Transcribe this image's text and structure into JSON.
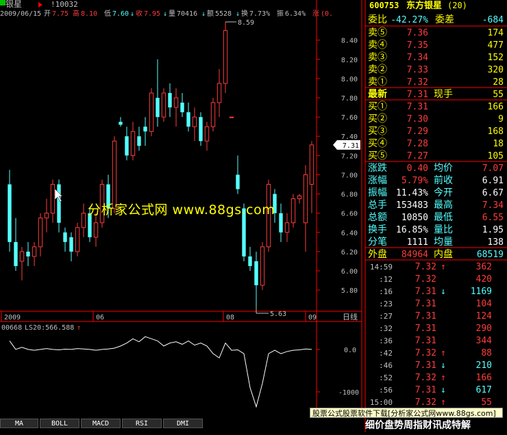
{
  "header": {
    "stock_name": "银星",
    "code_ref": "!10032",
    "date": "2009/06/15",
    "open_label": "开",
    "open": "7.75",
    "high_label": "高",
    "high": "8.10",
    "low_label": "低",
    "low": "7.60",
    "close_label": "收",
    "close": "7.95",
    "vol_label": "量",
    "vol": "70416",
    "amt_label": "额",
    "amt": "5528",
    "turn_label": "换",
    "turn": "7.73%",
    "amp_label": "振",
    "amp": "6.34%",
    "chg_label": "涨",
    "chg": "(0."
  },
  "chart": {
    "y_ticks": [
      "8.40",
      "8.20",
      "8.00",
      "7.80",
      "7.60",
      "7.40",
      "7.20",
      "7.00",
      "6.80",
      "6.60",
      "6.40",
      "6.20",
      "6.00",
      "5.80"
    ],
    "x_labels": [
      "2009",
      "06",
      "08",
      "09"
    ],
    "period_label": "日线",
    "current_price_label": "7.31",
    "max_label": "8.59",
    "min_label": "5.63"
  },
  "chart_data": [
    {
      "type": "candlestick",
      "title": "",
      "ylim": [
        5.63,
        8.59
      ],
      "y_ticks": [
        8.4,
        8.2,
        8.0,
        7.8,
        7.6,
        7.4,
        7.2,
        7.0,
        6.8,
        6.6,
        6.4,
        6.2,
        6.0,
        5.8
      ],
      "x_tick_labels": [
        "2009",
        "06",
        "08",
        "09"
      ],
      "candles": [
        {
          "o": 6.9,
          "h": 7.05,
          "l": 6.2,
          "c": 6.3
        },
        {
          "o": 6.3,
          "h": 6.55,
          "l": 6.0,
          "c": 6.05
        },
        {
          "o": 6.1,
          "h": 6.25,
          "l": 5.9,
          "c": 6.2
        },
        {
          "o": 6.2,
          "h": 6.3,
          "l": 6.05,
          "c": 6.15
        },
        {
          "o": 6.15,
          "h": 6.3,
          "l": 6.05,
          "c": 6.25
        },
        {
          "o": 6.25,
          "h": 6.6,
          "l": 6.15,
          "c": 6.55
        },
        {
          "o": 6.55,
          "h": 6.75,
          "l": 6.4,
          "c": 6.6
        },
        {
          "o": 6.6,
          "h": 6.95,
          "l": 6.5,
          "c": 6.9
        },
        {
          "o": 6.9,
          "h": 6.95,
          "l": 6.4,
          "c": 6.5
        },
        {
          "o": 6.4,
          "h": 6.45,
          "l": 6.2,
          "c": 6.3
        },
        {
          "o": 6.35,
          "h": 6.4,
          "l": 6.1,
          "c": 6.2
        },
        {
          "o": 6.2,
          "h": 6.5,
          "l": 6.15,
          "c": 6.45
        },
        {
          "o": 6.45,
          "h": 6.7,
          "l": 6.35,
          "c": 6.6
        },
        {
          "o": 6.6,
          "h": 6.65,
          "l": 6.3,
          "c": 6.35
        },
        {
          "o": 6.35,
          "h": 6.6,
          "l": 6.25,
          "c": 6.5
        },
        {
          "o": 6.5,
          "h": 6.95,
          "l": 6.45,
          "c": 6.9
        },
        {
          "o": 6.9,
          "h": 7.0,
          "l": 6.55,
          "c": 6.65
        },
        {
          "o": 6.65,
          "h": 7.4,
          "l": 6.6,
          "c": 7.35
        },
        {
          "o": 7.55,
          "h": 7.6,
          "l": 7.5,
          "c": 7.52
        },
        {
          "o": 7.4,
          "h": 7.5,
          "l": 7.15,
          "c": 7.2
        },
        {
          "o": 7.2,
          "h": 7.55,
          "l": 7.15,
          "c": 7.45
        },
        {
          "o": 7.4,
          "h": 7.5,
          "l": 7.25,
          "c": 7.3
        },
        {
          "o": 7.5,
          "h": 7.6,
          "l": 7.3,
          "c": 7.45
        },
        {
          "o": 7.45,
          "h": 7.9,
          "l": 7.4,
          "c": 7.85
        },
        {
          "o": 7.8,
          "h": 8.2,
          "l": 7.5,
          "c": 7.6
        },
        {
          "o": 7.6,
          "h": 7.9,
          "l": 7.55,
          "c": 7.85
        },
        {
          "o": 7.85,
          "h": 7.95,
          "l": 7.6,
          "c": 7.7
        },
        {
          "o": 7.7,
          "h": 7.9,
          "l": 7.5,
          "c": 7.8
        },
        {
          "o": 7.75,
          "h": 7.85,
          "l": 7.6,
          "c": 7.65
        },
        {
          "o": 7.65,
          "h": 7.75,
          "l": 7.45,
          "c": 7.5
        },
        {
          "o": 7.5,
          "h": 7.7,
          "l": 7.35,
          "c": 7.6
        },
        {
          "o": 7.6,
          "h": 7.65,
          "l": 7.3,
          "c": 7.35
        },
        {
          "o": 7.35,
          "h": 7.55,
          "l": 7.25,
          "c": 7.5
        },
        {
          "o": 7.5,
          "h": 7.8,
          "l": 7.45,
          "c": 7.75
        },
        {
          "o": 7.75,
          "h": 8.1,
          "l": 7.6,
          "c": 7.95
        },
        {
          "o": 7.95,
          "h": 8.59,
          "l": 7.85,
          "c": 8.5
        },
        {
          "o": 7.6,
          "h": 7.6,
          "l": 7.6,
          "c": 7.6
        },
        {
          "o": 7.0,
          "h": 7.2,
          "l": 6.8,
          "c": 6.85
        },
        {
          "o": 6.65,
          "h": 6.7,
          "l": 6.1,
          "c": 6.15
        },
        {
          "o": 6.15,
          "h": 6.25,
          "l": 6.0,
          "c": 6.05
        },
        {
          "o": 6.1,
          "h": 6.2,
          "l": 5.63,
          "c": 5.85
        },
        {
          "o": 5.85,
          "h": 6.3,
          "l": 5.8,
          "c": 6.25
        },
        {
          "o": 6.25,
          "h": 6.95,
          "l": 6.2,
          "c": 6.9
        },
        {
          "o": 6.8,
          "h": 6.85,
          "l": 6.5,
          "c": 6.6
        },
        {
          "o": 6.6,
          "h": 6.7,
          "l": 6.3,
          "c": 6.4
        },
        {
          "o": 6.4,
          "h": 6.6,
          "l": 6.3,
          "c": 6.5
        },
        {
          "o": 6.5,
          "h": 6.8,
          "l": 6.45,
          "c": 6.75
        },
        {
          "o": 6.75,
          "h": 6.8,
          "l": 6.7,
          "c": 6.78
        },
        {
          "o": 6.5,
          "h": 7.1,
          "l": 6.2,
          "c": 7.0
        },
        {
          "o": 6.9,
          "h": 7.35,
          "l": 6.6,
          "c": 7.31
        }
      ]
    },
    {
      "type": "line",
      "title": "LS20:566.588",
      "series_label": "00668",
      "y_ticks": [
        0.0,
        -1000
      ],
      "ylim": [
        -1500,
        400
      ],
      "values": [
        200,
        0,
        50,
        0,
        -20,
        0,
        20,
        0,
        -10,
        5,
        0,
        20,
        10,
        0,
        -20,
        0,
        10,
        30,
        80,
        150,
        250,
        180,
        300,
        250,
        200,
        80,
        150,
        180,
        120,
        200,
        100,
        150,
        80,
        -100,
        -200,
        150,
        -20,
        -10,
        -100,
        -900,
        -1350,
        -800,
        -100,
        -20,
        -100,
        -50,
        -20,
        -10,
        10,
        0
      ]
    }
  ],
  "quote": {
    "code": "600753",
    "name": "东方银星",
    "suffix": "(20)",
    "ratio_label": "委比",
    "ratio": "-42.27%",
    "diff_label": "委差",
    "diff": "-684",
    "sells": [
      {
        "label": "卖⑤",
        "price": "7.36",
        "vol": "174"
      },
      {
        "label": "卖④",
        "price": "7.35",
        "vol": "477"
      },
      {
        "label": "卖③",
        "price": "7.34",
        "vol": "152"
      },
      {
        "label": "卖②",
        "price": "7.33",
        "vol": "320"
      },
      {
        "label": "卖①",
        "price": "7.32",
        "vol": "28"
      }
    ],
    "last_label": "最新",
    "last": "7.31",
    "cur_hand_label": "现手",
    "cur_hand": "55",
    "buys": [
      {
        "label": "买①",
        "price": "7.31",
        "vol": "166"
      },
      {
        "label": "买②",
        "price": "7.30",
        "vol": "9"
      },
      {
        "label": "买③",
        "price": "7.29",
        "vol": "168"
      },
      {
        "label": "买④",
        "price": "7.28",
        "vol": "18"
      },
      {
        "label": "买⑤",
        "price": "7.27",
        "vol": "105"
      }
    ],
    "stats": [
      {
        "l1": "涨跌",
        "v1": "0.40",
        "l2": "均价",
        "v2": "7.07"
      },
      {
        "l1": "涨幅",
        "v1": "5.79%",
        "l2": "前收",
        "v2": "6.91"
      },
      {
        "l1": "振幅",
        "v1": "11.43%",
        "l2": "今开",
        "v2": "6.67"
      },
      {
        "l1": "总手",
        "v1": "153483",
        "l2": "最高",
        "v2": "7.34"
      },
      {
        "l1": "总额",
        "v1": "10850",
        "l2": "最低",
        "v2": "6.55"
      },
      {
        "l1": "换手",
        "v1": "16.85%",
        "l2": "量比",
        "v2": "1.95"
      },
      {
        "l1": "分笔",
        "v1": "1111",
        "l2": "均量",
        "v2": "138"
      }
    ],
    "outer_label": "外盘",
    "outer": "84964",
    "inner_label": "内盘",
    "inner": "68519",
    "ticks": [
      {
        "t": "14:59",
        "p": "7.32",
        "d": "up",
        "v": "362"
      },
      {
        "t": ":12",
        "p": "7.32",
        "d": "",
        "v": "420"
      },
      {
        "t": ":16",
        "p": "7.31",
        "d": "down",
        "v": "1169"
      },
      {
        "t": ":23",
        "p": "7.31",
        "d": "",
        "v": "104"
      },
      {
        "t": ":27",
        "p": "7.31",
        "d": "",
        "v": "124"
      },
      {
        "t": ":32",
        "p": "7.31",
        "d": "",
        "v": "290"
      },
      {
        "t": ":36",
        "p": "7.31",
        "d": "",
        "v": "344"
      },
      {
        "t": ":42",
        "p": "7.32",
        "d": "up",
        "v": "88"
      },
      {
        "t": ":46",
        "p": "7.31",
        "d": "down",
        "v": "210"
      },
      {
        "t": ":52",
        "p": "7.32",
        "d": "up",
        "v": "166"
      },
      {
        "t": ":56",
        "p": "7.31",
        "d": "down",
        "v": "617"
      },
      {
        "t": "15:00",
        "p": "7.32",
        "d": "up",
        "v": "55"
      }
    ]
  },
  "indicator": {
    "code": "00668",
    "formula": "LS20:566.588",
    "zero_label": "0.0",
    "neg_label": "-1000"
  },
  "tabs": [
    "MA",
    "BOLL",
    "MACD",
    "RSI",
    "DMI"
  ],
  "watermark": "分析家公式网 www.88gs.com",
  "footer_banner": "股票公式股票软件下载[分析家公式网www.88gs.com]",
  "footer_ticker": "细价盘势周指财讯成特解",
  "colors": {
    "up": "#ff3c3c",
    "down": "#54ffff",
    "text": "#c0c0c0",
    "yellow": "#ffff00",
    "grid": "#ff0000"
  }
}
